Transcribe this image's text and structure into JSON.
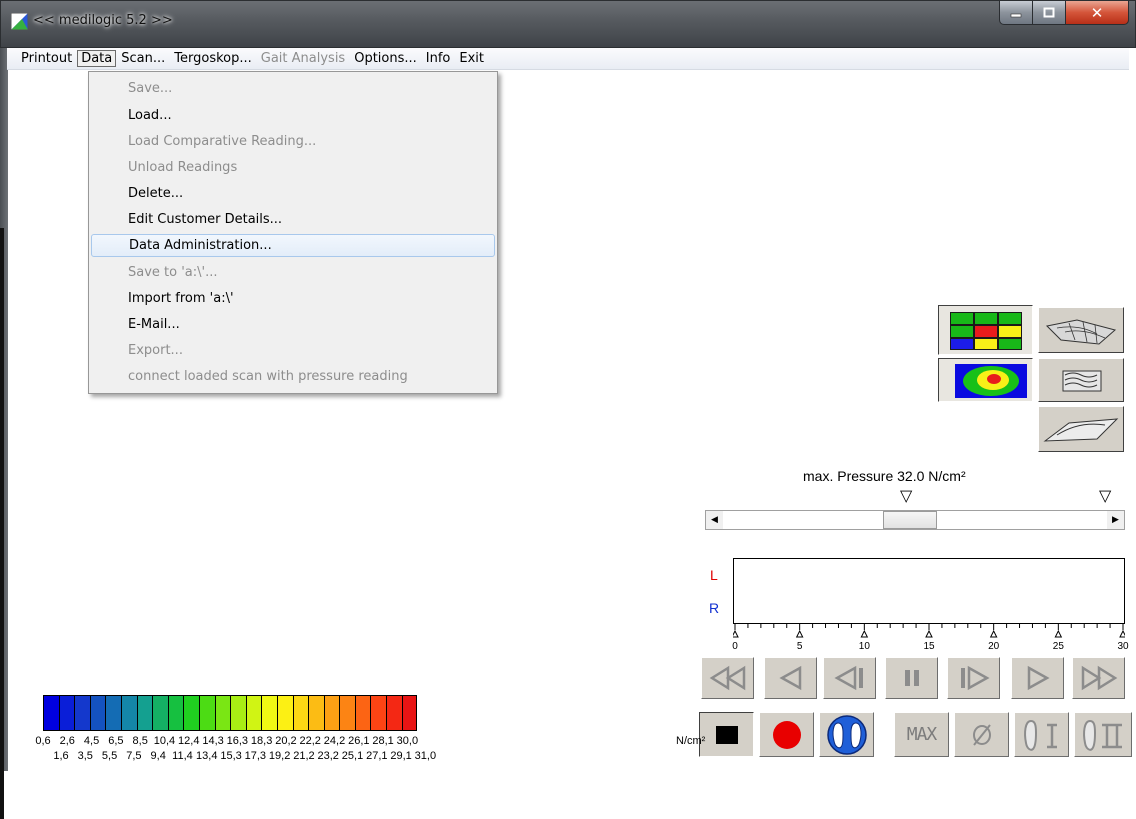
{
  "window": {
    "title": "<< medilogic 5.2 >>"
  },
  "menubar": {
    "items": [
      {
        "label": "Printout",
        "enabled": true
      },
      {
        "label": "Data",
        "enabled": true,
        "active": true
      },
      {
        "label": "Scan...",
        "enabled": true
      },
      {
        "label": "Tergoskop...",
        "enabled": true
      },
      {
        "label": "Gait Analysis",
        "enabled": false
      },
      {
        "label": "Options...",
        "enabled": true
      },
      {
        "label": "Info",
        "enabled": true
      },
      {
        "label": "Exit",
        "enabled": true
      }
    ]
  },
  "data_menu": {
    "items": [
      {
        "label": "Save...",
        "enabled": false
      },
      {
        "label": "Load...",
        "enabled": true
      },
      {
        "label": "Load Comparative Reading...",
        "enabled": false
      },
      {
        "label": "Unload Readings",
        "enabled": false
      },
      {
        "label": "Delete...",
        "enabled": true
      },
      {
        "label": "Edit Customer Details...",
        "enabled": true
      },
      {
        "label": "Data Administration...",
        "enabled": true,
        "highlighted": true
      },
      {
        "label": "Save to 'a:\\'...",
        "enabled": false
      },
      {
        "label": "Import from 'a:\\'",
        "enabled": true
      },
      {
        "label": "E-Mail...",
        "enabled": true
      },
      {
        "label": "Export...",
        "enabled": false
      },
      {
        "label": "connect loaded scan with pressure reading",
        "enabled": false
      }
    ]
  },
  "pressure": {
    "label": "max. Pressure 32.0 N/cm²"
  },
  "timeline": {
    "left_label": "L",
    "right_label": "R",
    "ticks": [
      "0",
      "5",
      "10",
      "15",
      "20",
      "25",
      "30"
    ],
    "left_color": "#e00000",
    "right_color": "#1030d0"
  },
  "playback": {
    "buttons": [
      "rewind-to-start",
      "step-back",
      "frame-back",
      "pause",
      "frame-forward",
      "play",
      "fast-forward"
    ]
  },
  "modes": {
    "buttons": [
      "stop",
      "record",
      "both-feet",
      "max",
      "zero",
      "left-foot",
      "right-foot"
    ],
    "max_label": "MAX"
  },
  "scale": {
    "unit": "N/cm²",
    "top_values": [
      "0,6",
      "2,6",
      "4,5",
      "6,5",
      "8,5",
      "10,4",
      "12,4",
      "14,3",
      "16,3",
      "18,3",
      "20,2",
      "22,2",
      "24,2",
      "26,1",
      "28,1",
      "30,0"
    ],
    "bottom_values": [
      "1,6",
      "3,5",
      "5,5",
      "7,5",
      "9,4",
      "11,4",
      "13,4",
      "15,3",
      "17,3",
      "19,2",
      "21,2",
      "23,2",
      "25,1",
      "27,1",
      "29,1",
      "31,0"
    ],
    "colors": [
      "#0000e0",
      "#0a1ed8",
      "#1438cc",
      "#1452c0",
      "#146cb4",
      "#1486a8",
      "#14a090",
      "#14b064",
      "#16c040",
      "#20d020",
      "#4cdc14",
      "#7ae614",
      "#a8ee14",
      "#d0f414",
      "#f0f814",
      "#fcf014",
      "#fcd814",
      "#fcbc14",
      "#fca014",
      "#fc8414",
      "#fc6414",
      "#fc4414",
      "#f42814",
      "#e81414"
    ]
  }
}
